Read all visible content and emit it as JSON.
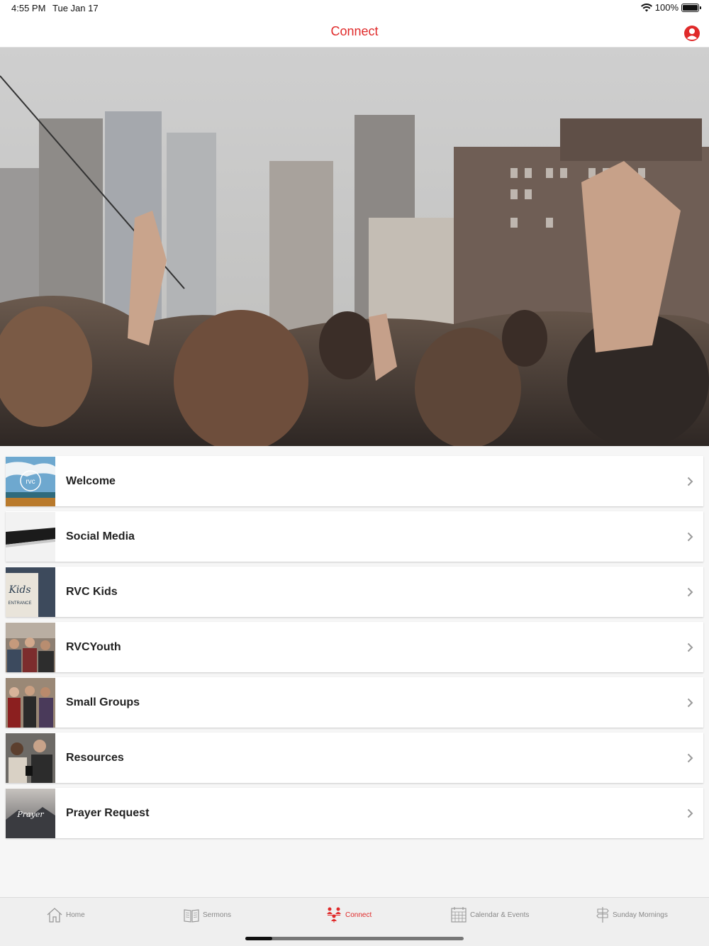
{
  "status_bar": {
    "time": "4:55 PM",
    "date": "Tue Jan 17",
    "battery": "100%",
    "icons": [
      "wifi-icon",
      "battery-icon"
    ]
  },
  "nav": {
    "title": "Connect",
    "profile_icon": "profile-icon",
    "accent_color": "#e02a2a"
  },
  "hero": {
    "image": "rooftop-worship-crowd-city-skyline"
  },
  "list": {
    "items": [
      {
        "label": "Welcome",
        "thumb": "rvc-logo-sky"
      },
      {
        "label": "Social Media",
        "thumb": "smartphone"
      },
      {
        "label": "RVC Kids",
        "thumb": "rvc-kids-entrance-sign"
      },
      {
        "label": "RVCYouth",
        "thumb": "youth-group"
      },
      {
        "label": "Small Groups",
        "thumb": "small-group-people"
      },
      {
        "label": "Resources",
        "thumb": "people-with-phones"
      },
      {
        "label": "Prayer Request",
        "thumb": "prayer-request-mountains"
      }
    ]
  },
  "tabs": [
    {
      "label": "Home",
      "icon": "home-icon",
      "active": false
    },
    {
      "label": "Sermons",
      "icon": "book-icon",
      "active": false
    },
    {
      "label": "Connect",
      "icon": "connect-people-icon",
      "active": true
    },
    {
      "label": "Calendar & Events",
      "icon": "calendar-icon",
      "active": false
    },
    {
      "label": "Sunday Mornings",
      "icon": "signpost-icon",
      "active": false
    }
  ]
}
